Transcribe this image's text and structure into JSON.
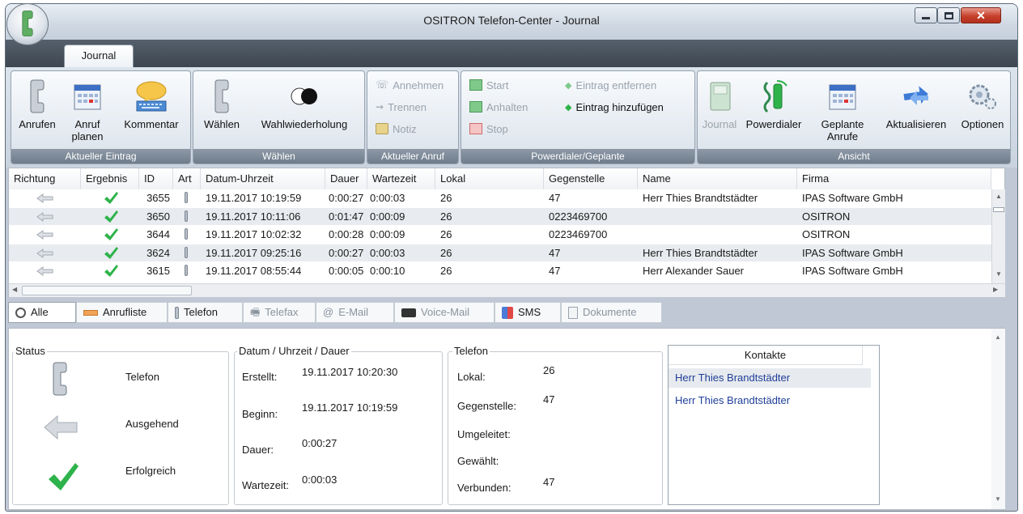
{
  "window": {
    "title": "OSITRON Telefon-Center - Journal",
    "controls": {
      "minimize": "minimize-icon",
      "maximize": "maximize-icon",
      "close": "close-icon"
    }
  },
  "tabs": {
    "journal": "Journal"
  },
  "ribbon": {
    "groups": {
      "aktueller_eintrag": "Aktueller Eintrag",
      "waehlen": "Wählen",
      "aktueller_anruf": "Aktueller Anruf",
      "powerdialer": "Powerdialer/Geplante",
      "ansicht": "Ansicht"
    },
    "buttons": {
      "anrufen": "Anrufen",
      "anruf_planen_1": "Anruf",
      "anruf_planen_2": "planen",
      "kommentar": "Kommentar",
      "waehlen": "Wählen",
      "wahlwiederholung": "Wahlwiederholung",
      "annehmen": "Annehmen",
      "trennen": "Trennen",
      "notiz": "Notiz",
      "start": "Start",
      "anhalten": "Anhalten",
      "stop": "Stop",
      "eintrag_entfernen": "Eintrag entfernen",
      "eintrag_hinzufuegen": "Eintrag hinzufügen",
      "journal": "Journal",
      "powerdialer": "Powerdialer",
      "geplante_1": "Geplante",
      "geplante_2": "Anrufe",
      "aktualisieren": "Aktualisieren",
      "optionen": "Optionen"
    }
  },
  "grid": {
    "columns": {
      "richtung": "Richtung",
      "ergebnis": "Ergebnis",
      "id": "ID",
      "art": "Art",
      "datum": "Datum-Uhrzeit",
      "dauer": "Dauer",
      "wartezeit": "Wartezeit",
      "lokal": "Lokal",
      "gegenstelle": "Gegenstelle",
      "name": "Name",
      "firma": "Firma"
    },
    "rows": [
      {
        "id": "3655",
        "datum": "19.11.2017 10:19:59",
        "dauer": "0:00:27",
        "wartezeit": "0:00:03",
        "lokal": "26",
        "gegenstelle": "47",
        "name": "Herr Thies Brandtstädter",
        "firma": "IPAS Software GmbH"
      },
      {
        "id": "3650",
        "datum": "19.11.2017 10:11:06",
        "dauer": "0:01:47",
        "wartezeit": "0:00:09",
        "lokal": "26",
        "gegenstelle": "0223469700",
        "name": "",
        "firma": "OSITRON"
      },
      {
        "id": "3644",
        "datum": "19.11.2017 10:02:32",
        "dauer": "0:00:28",
        "wartezeit": "0:00:09",
        "lokal": "26",
        "gegenstelle": "0223469700",
        "name": "",
        "firma": "OSITRON"
      },
      {
        "id": "3624",
        "datum": "19.11.2017 09:25:16",
        "dauer": "0:00:27",
        "wartezeit": "0:00:03",
        "lokal": "26",
        "gegenstelle": "47",
        "name": "Herr Thies Brandtstädter",
        "firma": "IPAS Software GmbH"
      },
      {
        "id": "3615",
        "datum": "19.11.2017 08:55:44",
        "dauer": "0:00:05",
        "wartezeit": "0:00:10",
        "lokal": "26",
        "gegenstelle": "47",
        "name": "Herr Alexander Sauer",
        "firma": "IPAS Software GmbH"
      }
    ]
  },
  "filters": {
    "alle": "Alle",
    "anrufliste": "Anrufliste",
    "telefon": "Telefon",
    "telefax": "Telefax",
    "email": "E-Mail",
    "voicemail": "Voice-Mail",
    "sms": "SMS",
    "dokumente": "Dokumente"
  },
  "details": {
    "status": {
      "legend": "Status",
      "telefon": "Telefon",
      "ausgehend": "Ausgehend",
      "erfolgreich": "Erfolgreich"
    },
    "datum": {
      "legend": "Datum / Uhrzeit / Dauer",
      "erstellt_lbl": "Erstellt:",
      "erstellt": "19.11.2017 10:20:30",
      "beginn_lbl": "Beginn:",
      "beginn": "19.11.2017 10:19:59",
      "dauer_lbl": "Dauer:",
      "dauer": "0:00:27",
      "wartezeit_lbl": "Wartezeit:",
      "wartezeit": "0:00:03"
    },
    "telefon": {
      "legend": "Telefon",
      "lokal_lbl": "Lokal:",
      "lokal": "26",
      "gegenstelle_lbl": "Gegenstelle:",
      "gegenstelle": "47",
      "umgeleitet_lbl": "Umgeleitet:",
      "gewaehlt_lbl": "Gewählt:",
      "verbunden_lbl": "Verbunden:",
      "verbunden": "47"
    },
    "kontakte": {
      "header": "Kontakte",
      "items": [
        "Herr Thies Brandtstädter",
        "Herr Thies Brandtstädter"
      ]
    }
  },
  "colors": {
    "accent_green": "#2db34a",
    "link_blue": "#1f3f9a",
    "ribbon_label_bg": "#7b8797"
  }
}
